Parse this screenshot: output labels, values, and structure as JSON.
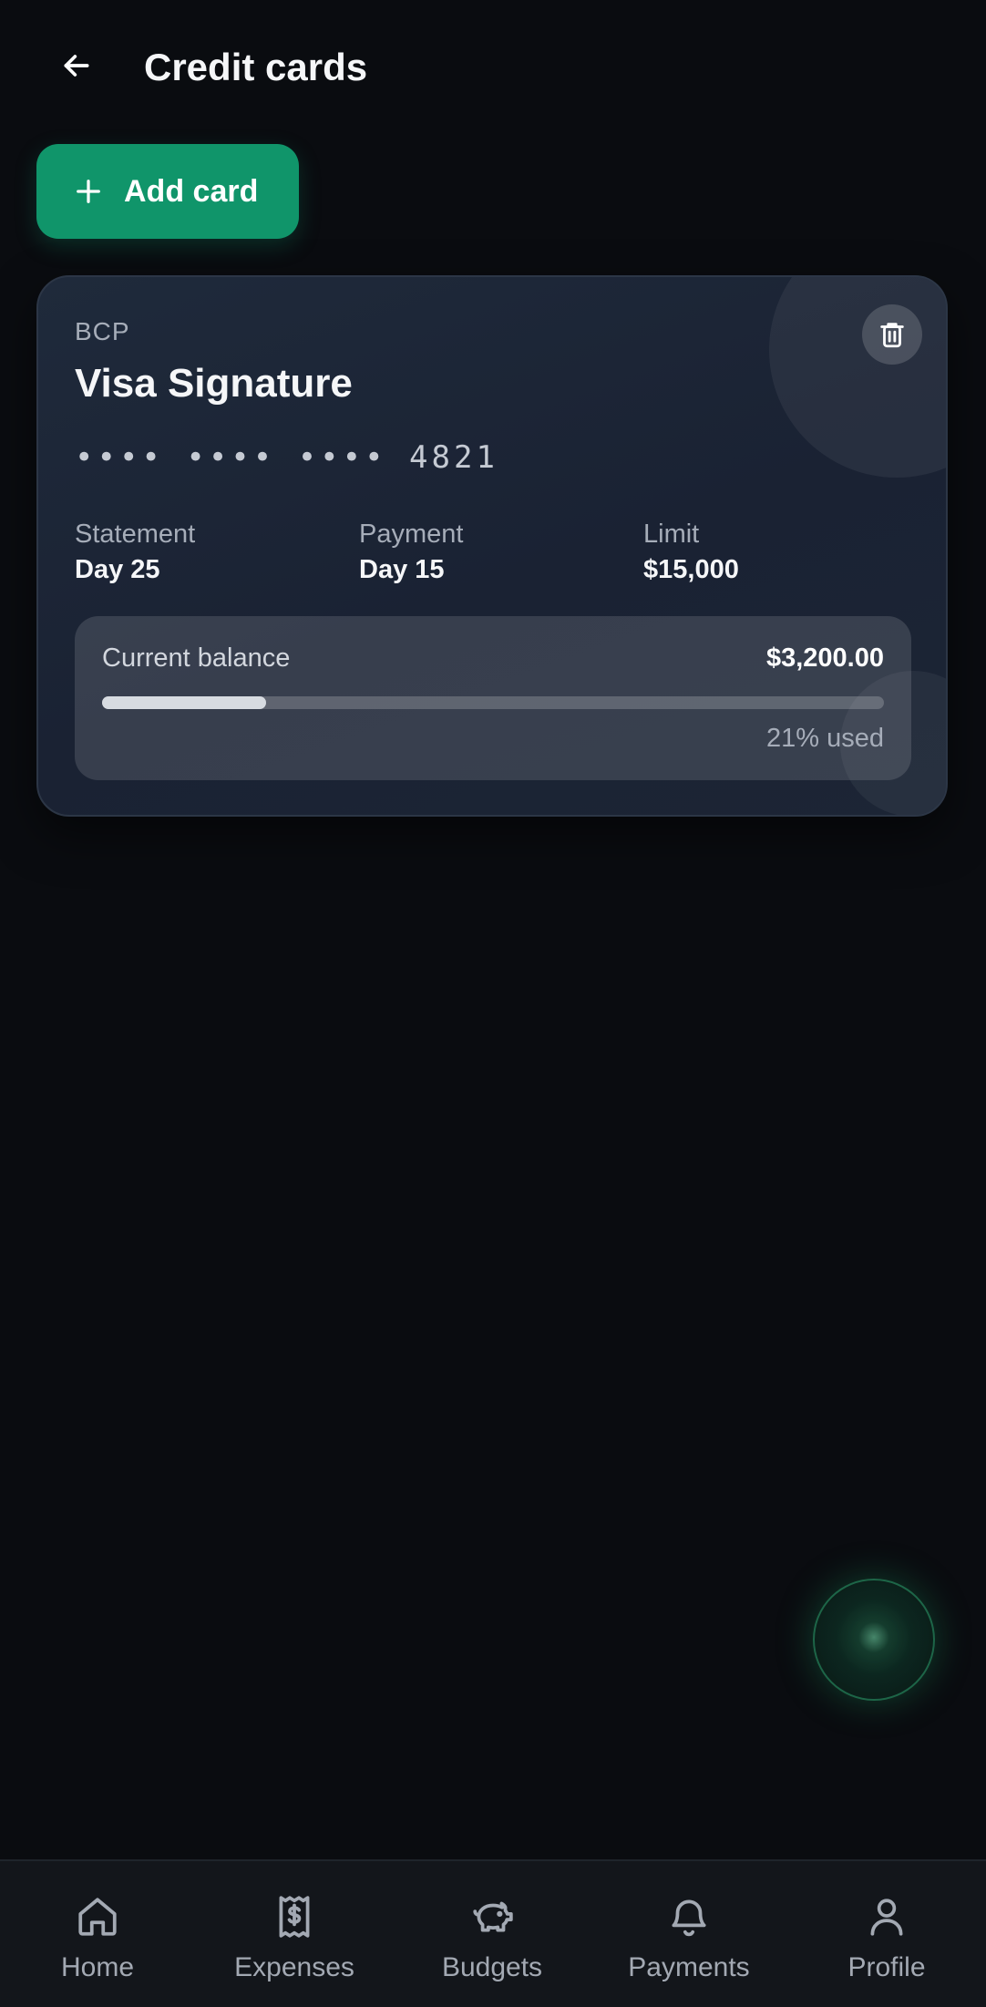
{
  "header": {
    "title": "Credit cards",
    "back_icon": "arrow-left-icon"
  },
  "actions": {
    "add_card_label": "Add card",
    "add_icon": "plus-icon"
  },
  "card": {
    "bank": "BCP",
    "name": "Visa Signature",
    "masked_number": "•••• •••• •••• 4821",
    "delete_icon": "trash-icon",
    "statement_label": "Statement",
    "statement_value": "Day 25",
    "payment_label": "Payment",
    "payment_value": "Day 15",
    "limit_label": "Limit",
    "limit_value": "$15,000",
    "balance_label": "Current balance",
    "balance_value": "$3,200.00",
    "used_text": "21% used",
    "used_fraction": 0.21
  },
  "nav": {
    "items": [
      {
        "label": "Home",
        "icon": "home-icon"
      },
      {
        "label": "Expenses",
        "icon": "receipt-icon"
      },
      {
        "label": "Budgets",
        "icon": "piggy-bank-icon"
      },
      {
        "label": "Payments",
        "icon": "bell-icon"
      },
      {
        "label": "Profile",
        "icon": "user-icon"
      }
    ]
  },
  "colors": {
    "background": "#0a0c10",
    "accent": "#10956a",
    "card": "#1f2a3b",
    "nav_background": "#13161b"
  }
}
